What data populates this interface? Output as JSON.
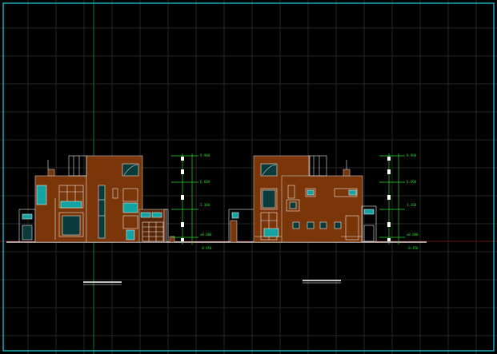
{
  "view": {
    "name": "cad-elevation-drawing",
    "background_color": "#000000",
    "border_color": "#1fd1e0",
    "wall_color": "#7a3508",
    "glass_color": "#14a3a3",
    "dimension_color": "#2ad42a"
  },
  "elevations": [
    {
      "id": "left",
      "levels": [
        "9.900",
        "6.600",
        "3.300",
        "±0.000",
        "-0.450"
      ]
    },
    {
      "id": "right",
      "levels": [
        "9.900",
        "6.600",
        "3.300",
        "±0.000",
        "-0.450"
      ]
    }
  ]
}
